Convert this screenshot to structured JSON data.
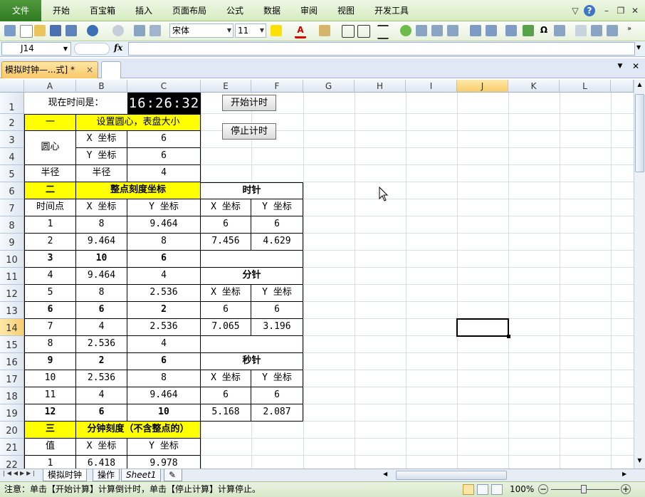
{
  "ribbon": {
    "file_tab": "文件",
    "tabs": [
      "开始",
      "百宝箱",
      "插入",
      "页面布局",
      "公式",
      "数据",
      "审阅",
      "视图",
      "开发工具"
    ]
  },
  "toolbar": {
    "font_name": "宋体",
    "font_size": "11"
  },
  "formula_bar": {
    "name_box": "J14",
    "fx_label": "fx",
    "formula": ""
  },
  "workbook_tab": {
    "title": "模拟时钟—...式] *",
    "close": "×"
  },
  "columns": [
    "A",
    "B",
    "C",
    "E",
    "F",
    "G",
    "H",
    "I",
    "J",
    "K",
    "L"
  ],
  "rows": [
    "1",
    "2",
    "3",
    "4",
    "5",
    "6",
    "7",
    "8",
    "9",
    "10",
    "11",
    "12",
    "13",
    "14",
    "15",
    "16",
    "17",
    "18",
    "19",
    "20",
    "21",
    "22"
  ],
  "sheet": {
    "current_time_label": "现在时间是：",
    "clock": "16:26:32",
    "start_button": "开始计时",
    "stop_button": "停止计时",
    "sec1": "一",
    "sec1_title": "设置圆心，表盘大小",
    "center": "圆心",
    "x_coord": "X 坐标",
    "y_coord": "Y 坐标",
    "center_x": "6",
    "center_y": "6",
    "radius_label": "半径",
    "radius_sub": "半径",
    "radius": "4",
    "sec2": "二",
    "sec2_title": "整点刻度坐标",
    "hour_hand": "时针",
    "minute_hand": "分针",
    "second_hand": "秒针",
    "time_point": "时间点",
    "hours": [
      [
        "1",
        "8",
        "9.464"
      ],
      [
        "2",
        "9.464",
        "8"
      ],
      [
        "3",
        "10",
        "6"
      ],
      [
        "4",
        "9.464",
        "4"
      ],
      [
        "5",
        "8",
        "2.536"
      ],
      [
        "6",
        "6",
        "2"
      ],
      [
        "7",
        "4",
        "2.536"
      ],
      [
        "8",
        "2.536",
        "4"
      ],
      [
        "9",
        "2",
        "6"
      ],
      [
        "10",
        "2.536",
        "8"
      ],
      [
        "11",
        "4",
        "9.464"
      ],
      [
        "12",
        "6",
        "10"
      ]
    ],
    "hour_hand_vals": {
      "x1": "6",
      "y1": "6",
      "x2": "7.456",
      "y2": "4.629"
    },
    "minute_hand_vals": {
      "x1": "6",
      "y1": "6",
      "x2": "7.065",
      "y2": "3.196"
    },
    "second_hand_vals": {
      "x1": "6",
      "y1": "6",
      "x2": "5.168",
      "y2": "2.087"
    },
    "sec3": "三",
    "sec3_title": "分钟刻度（不含整点的）",
    "value_label": "值",
    "row22": [
      "1",
      "6.418",
      "9.978"
    ]
  },
  "sheet_tabs": [
    "模拟时钟",
    "操作",
    "Sheet1"
  ],
  "status": {
    "message": "注意：单击【开始计算】计算倒计时，单击【停止计算】计算停止。",
    "zoom": "100%"
  }
}
